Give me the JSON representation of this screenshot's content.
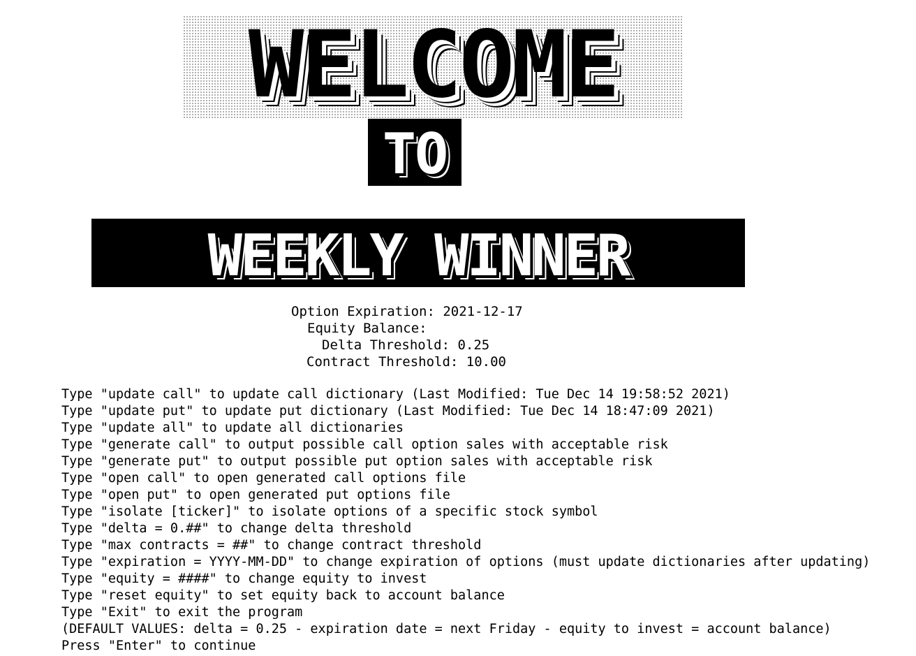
{
  "banner": {
    "line1": "WELCOME",
    "line2": "TO",
    "line3": "WEEKLY WINNER"
  },
  "status": {
    "expiration": "Option Expiration: 2021-12-17",
    "equity": "Equity Balance:",
    "delta": "Delta Threshold: 0.25",
    "contract": "Contract Threshold: 10.00"
  },
  "menu": {
    "lines": [
      "Type \"update call\" to update call dictionary (Last Modified: Tue Dec 14 19:58:52 2021)",
      "Type \"update put\" to update put dictionary (Last Modified: Tue Dec 14 18:47:09 2021)",
      "Type \"update all\" to update all dictionaries",
      "Type \"generate call\" to output possible call option sales with acceptable risk",
      "Type \"generate put\" to output possible put option sales with acceptable risk",
      "Type \"open call\" to open generated call options file",
      "Type \"open put\" to open generated put options file",
      "Type \"isolate [ticker]\" to isolate options of a specific stock symbol",
      "Type \"delta = 0.##\" to change delta threshold",
      "Type \"max contracts = ##\" to change contract threshold",
      "Type \"expiration = YYYY-MM-DD\" to change expiration of options (must update dictionaries after updating)",
      "Type \"equity = ####\" to change equity to invest",
      "Type \"reset equity\" to set equity back to account balance",
      "Type \"Exit\" to exit the program",
      "(DEFAULT VALUES: delta = 0.25 - expiration date = next Friday - equity to invest = account balance)",
      "Press \"Enter\" to continue"
    ]
  }
}
